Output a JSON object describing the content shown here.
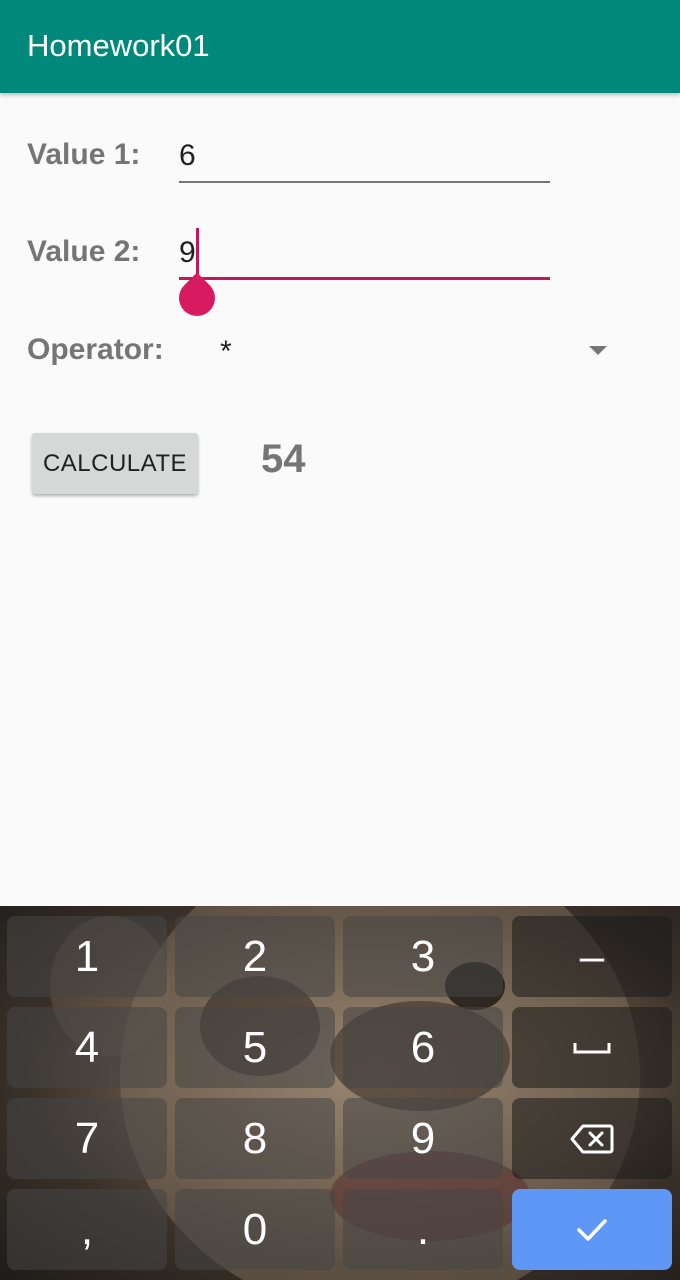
{
  "appbar": {
    "title": "Homework01",
    "color": "#00897b"
  },
  "form": {
    "value1": {
      "label": "Value 1:",
      "value": "6"
    },
    "value2": {
      "label": "Value 2:",
      "value": "9"
    },
    "operator": {
      "label": "Operator:",
      "selected": "*"
    }
  },
  "actions": {
    "calculate_label": "CALCULATE"
  },
  "result": {
    "value": "54"
  },
  "keyboard": {
    "keys": {
      "k1": "1",
      "k2": "2",
      "k3": "3",
      "minus": "–",
      "k4": "4",
      "k5": "5",
      "k6": "6",
      "k7": "7",
      "k8": "8",
      "k9": "9",
      "comma": ",",
      "k0": "0",
      "period": "."
    },
    "icons": {
      "space": "space-icon",
      "backspace": "backspace-icon",
      "enter": "checkmark-icon"
    },
    "enter_color": "#5e97f6"
  },
  "accent_color": "#c2185b"
}
